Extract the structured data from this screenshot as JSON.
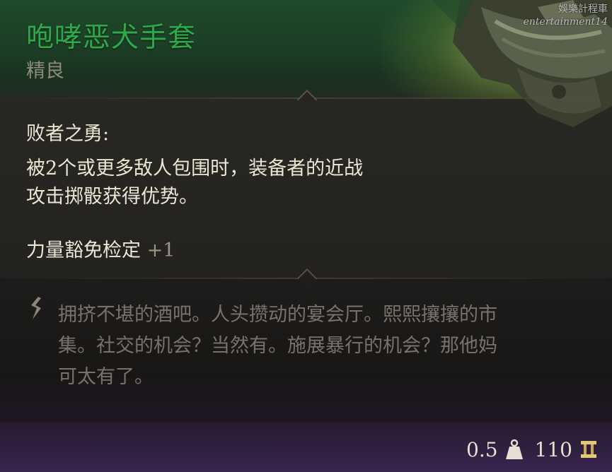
{
  "watermark": {
    "line1": "娛樂計程車",
    "line2": "entertainment14"
  },
  "item": {
    "name": "咆哮恶犬手套",
    "rarity": "精良"
  },
  "passive": {
    "title": "败者之勇:",
    "description_line1": "被2个或更多敌人包围时，装备者的近战",
    "description_line2": "攻击掷骰获得优势。"
  },
  "save": {
    "label": "力量豁免检定",
    "bonus": "+1"
  },
  "flavor": {
    "line1": "拥挤不堪的酒吧。人头攒动的宴会厅。熙熙攘攘的市",
    "line2": "集。社交的机会？当然有。施展暴行的机会？那他妈",
    "line3": "可太有了。"
  },
  "footer": {
    "weight": "0.5",
    "weight_icon": "weight-icon",
    "price": "110",
    "price_icon": "gold-coin-icon"
  },
  "colors": {
    "item_name": "#2ea84a",
    "rarity": "#8f8a7a",
    "body_text": "#ece6d4",
    "flavor_text": "#77736b"
  }
}
